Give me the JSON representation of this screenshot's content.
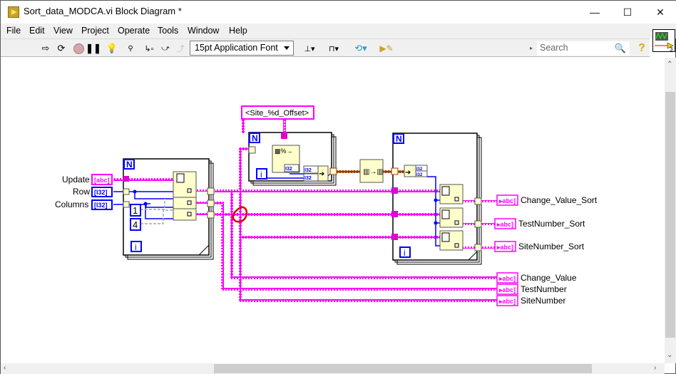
{
  "window": {
    "title": "Sort_data_MODCA.vi Block Diagram *",
    "controls": {
      "minimize": "—",
      "maximize": "☐",
      "close": "✕"
    }
  },
  "menu": [
    {
      "label": "File"
    },
    {
      "label": "Edit"
    },
    {
      "label": "View"
    },
    {
      "label": "Project"
    },
    {
      "label": "Operate"
    },
    {
      "label": "Tools"
    },
    {
      "label": "Window"
    },
    {
      "label": "Help"
    }
  ],
  "toolbar": {
    "icons": [
      "run-arrow-icon",
      "run-continuously-icon",
      "abort-icon",
      "pause-icon",
      "highlight-execution-icon",
      "retain-wire-values-icon",
      "step-into-icon",
      "step-over-icon",
      "step-out-icon"
    ],
    "font_select": "15pt Application Font",
    "align_icons": [
      "align-objects-icon",
      "distribute-objects-icon",
      "reorder-icon",
      "cleanup-diagram-icon"
    ],
    "search_placeholder": "Search",
    "help_glyph": "?"
  },
  "diagram": {
    "inputs": [
      {
        "label": "Update",
        "type": "abc",
        "color": "#ff00ff"
      },
      {
        "label": "Row",
        "type": "I32",
        "color": "#0000ff"
      },
      {
        "label": "Columns",
        "type": "I32",
        "color": "#0000ff"
      }
    ],
    "constants": {
      "one": "1",
      "four": "4"
    },
    "format_string": "<Site_%d_Offset>",
    "loop_count_label": "N",
    "loop_index_label": "i",
    "i32_label": "I32",
    "outputs_sorted": [
      {
        "label": "Change_Value_Sort",
        "type": "abc"
      },
      {
        "label": "TestNumber_Sort",
        "type": "abc"
      },
      {
        "label": "SiteNumber_Sort",
        "type": "abc"
      }
    ],
    "outputs_raw": [
      {
        "label": "Change_Value",
        "type": "abc"
      },
      {
        "label": "TestNumber",
        "type": "abc"
      },
      {
        "label": "SiteNumber",
        "type": "abc"
      }
    ],
    "colors": {
      "string_wire": "#ff00ff",
      "int_wire": "#0000ff",
      "cluster_wire": "#8b4513",
      "node_fill": "#ffffcc",
      "annotation": "#e00000"
    }
  }
}
